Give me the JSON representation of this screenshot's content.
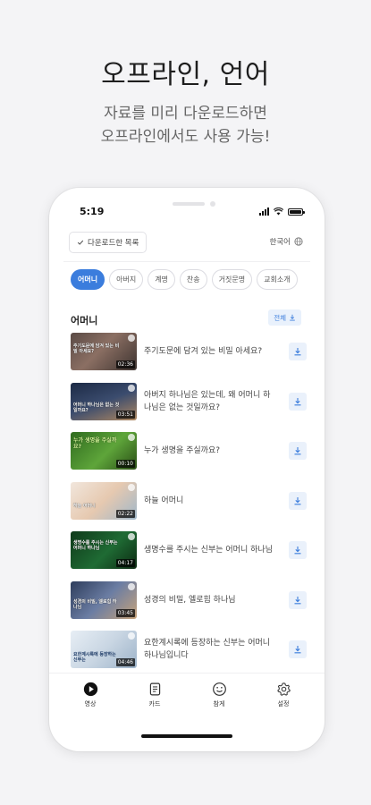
{
  "promo": {
    "title": "오프라인, 언어",
    "subtitle_line1": "자료를 미리 다운로드하면",
    "subtitle_line2": "오프라인에서도 사용 가능!"
  },
  "status_bar": {
    "time": "5:19"
  },
  "header": {
    "downloaded_list_label": "다운로드한 목록",
    "language_label": "한국어"
  },
  "categories": [
    {
      "label": "어머니",
      "active": true
    },
    {
      "label": "아버지",
      "active": false
    },
    {
      "label": "계명",
      "active": false
    },
    {
      "label": "찬송",
      "active": false
    },
    {
      "label": "거짓문명",
      "active": false
    },
    {
      "label": "교회소개",
      "active": false
    }
  ],
  "section": {
    "title": "어머니",
    "download_all_label": "전체"
  },
  "videos": [
    {
      "title": "주기도문에 담겨 있는 비밀 아세요?",
      "duration": "02:36",
      "thumb_caption": "주기도문에 담겨 있는 비밀 아세요?"
    },
    {
      "title": "아버지 하나님은 있는데, 왜 어머니 하나님은 없는 것일까요?",
      "duration": "03:51",
      "thumb_caption": "어머니 하나님은 없는 것일까요?"
    },
    {
      "title": "누가 생명을 주실까요?",
      "duration": "00:10",
      "thumb_caption": "누가 생명을 주실까요?"
    },
    {
      "title": "하늘 어머니",
      "duration": "02:22",
      "thumb_caption": "하늘 어머니"
    },
    {
      "title": "생명수를 주시는 신부는 어머니 하나님",
      "duration": "04:17",
      "thumb_caption": "생명수를 주시는 신부는 어머니 하나님"
    },
    {
      "title": "성경의 비밀, 엘로힘 하나님",
      "duration": "03:45",
      "thumb_caption": "성경의 비밀, 엘로힘 하나님"
    },
    {
      "title": "요한계시록에 등장하는 신부는 어머니 하나님입니다",
      "duration": "04:46",
      "thumb_caption": "요한계시록에 등장하는 신부는"
    }
  ],
  "tabs": [
    {
      "label": "영상",
      "icon": "play-circle-icon"
    },
    {
      "label": "카드",
      "icon": "card-icon"
    },
    {
      "label": "참게",
      "icon": "smile-icon"
    },
    {
      "label": "설정",
      "icon": "gear-icon"
    }
  ],
  "colors": {
    "accent": "#3b7ddd",
    "accent_light": "#eaf1fb"
  }
}
